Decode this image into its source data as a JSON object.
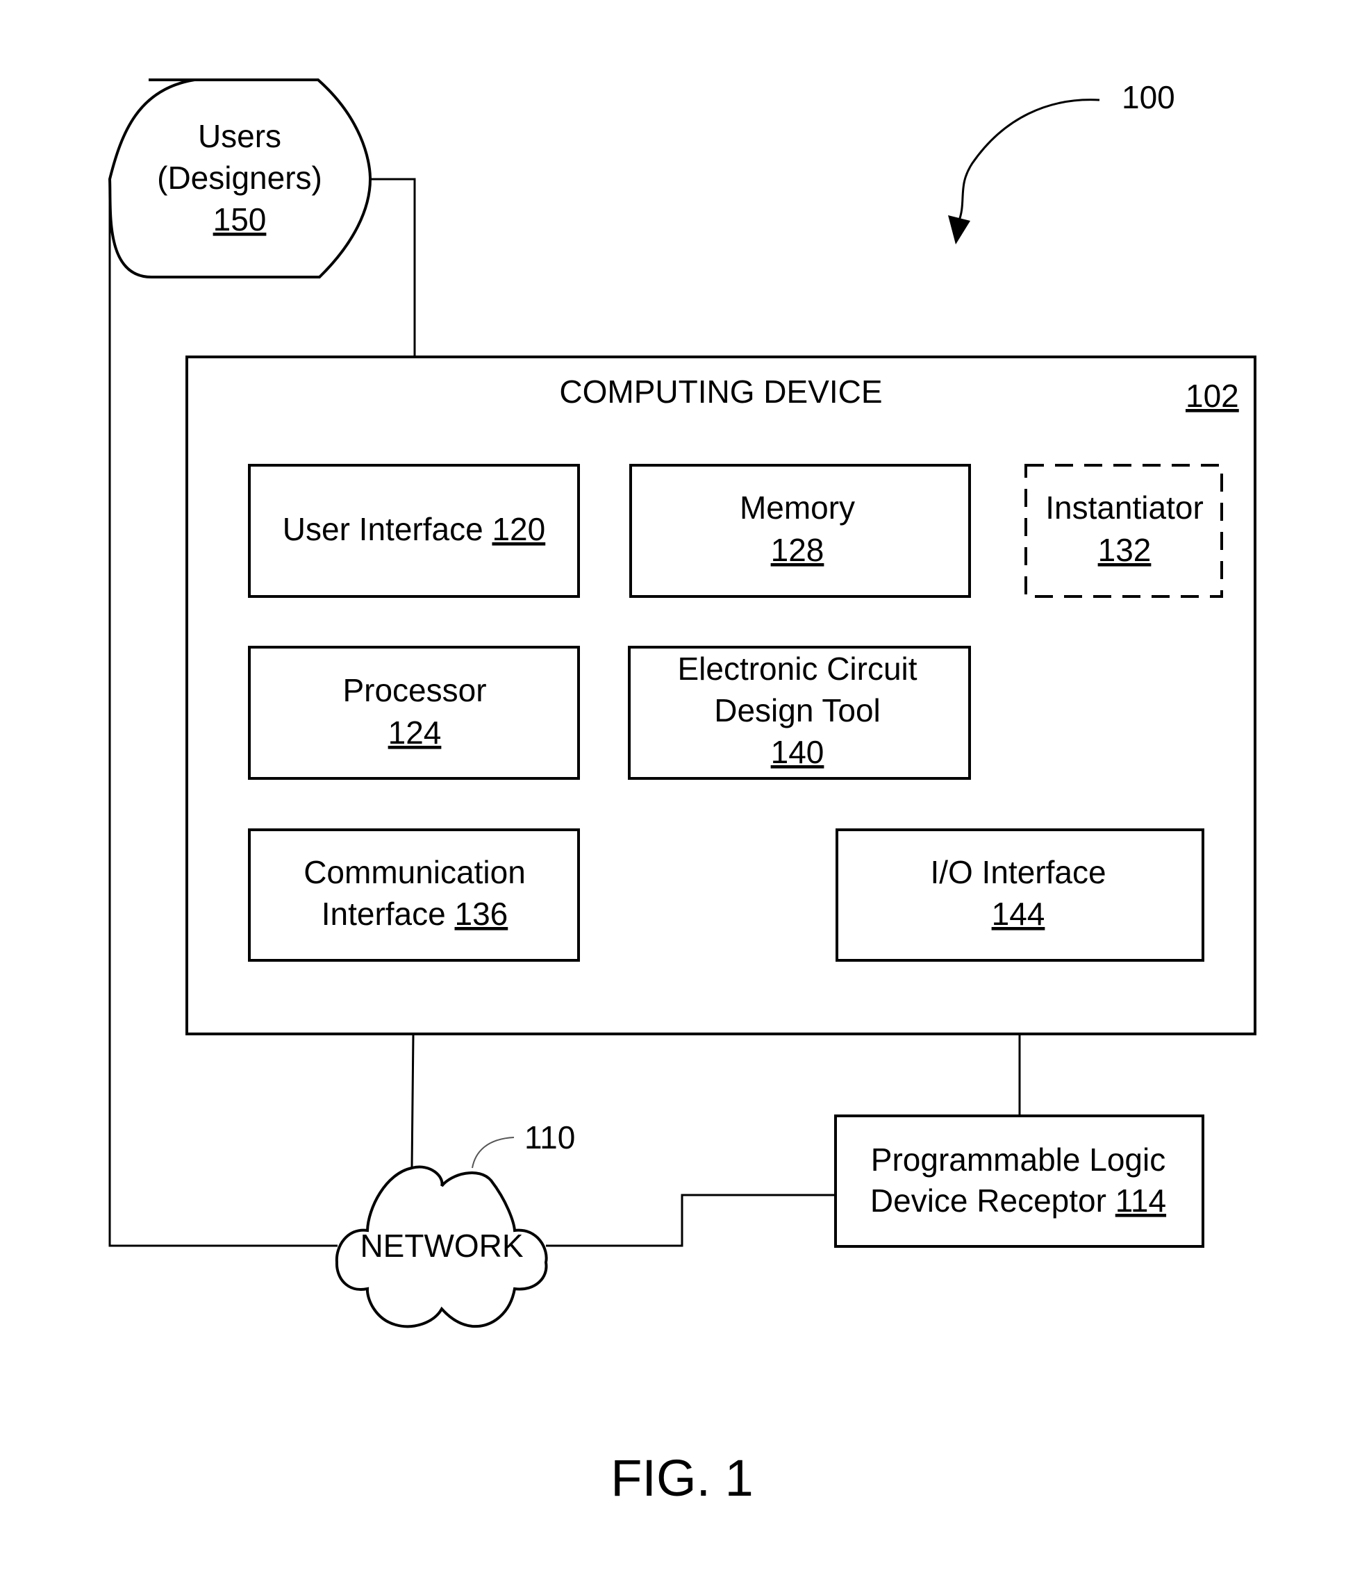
{
  "figure": {
    "caption": "FIG. 1",
    "system_ref": "100"
  },
  "users": {
    "line1": "Users",
    "line2": "(Designers)",
    "ref": "150"
  },
  "computing_device": {
    "title": "COMPUTING DEVICE",
    "ref": "102",
    "components": {
      "user_interface": {
        "line1": "User Interface ",
        "ref": "120"
      },
      "memory": {
        "line1": "Memory",
        "ref": "128"
      },
      "instantiator": {
        "line1": "Instantiator",
        "ref": "132",
        "style": "dashed"
      },
      "processor": {
        "line1": "Processor",
        "ref": "124"
      },
      "design_tool": {
        "line1": "Electronic Circuit",
        "line2": "Design Tool",
        "ref": "140"
      },
      "comm_interface": {
        "line1": "Communication",
        "line2": "Interface  ",
        "ref": "136"
      },
      "io_interface": {
        "line1": "I/O Interface",
        "ref": "144"
      }
    }
  },
  "network": {
    "label": "NETWORK",
    "ref": "110"
  },
  "pld_receptor": {
    "line1": "Programmable Logic",
    "line2": "Device Receptor ",
    "ref": "114"
  },
  "connections": [
    {
      "from": "users",
      "to": "user_interface"
    },
    {
      "from": "users",
      "to": "network"
    },
    {
      "from": "instantiator",
      "to": "design_tool"
    },
    {
      "from": "comm_interface",
      "to": "network"
    },
    {
      "from": "io_interface",
      "to": "pld_receptor"
    },
    {
      "from": "network",
      "to": "pld_receptor"
    }
  ]
}
